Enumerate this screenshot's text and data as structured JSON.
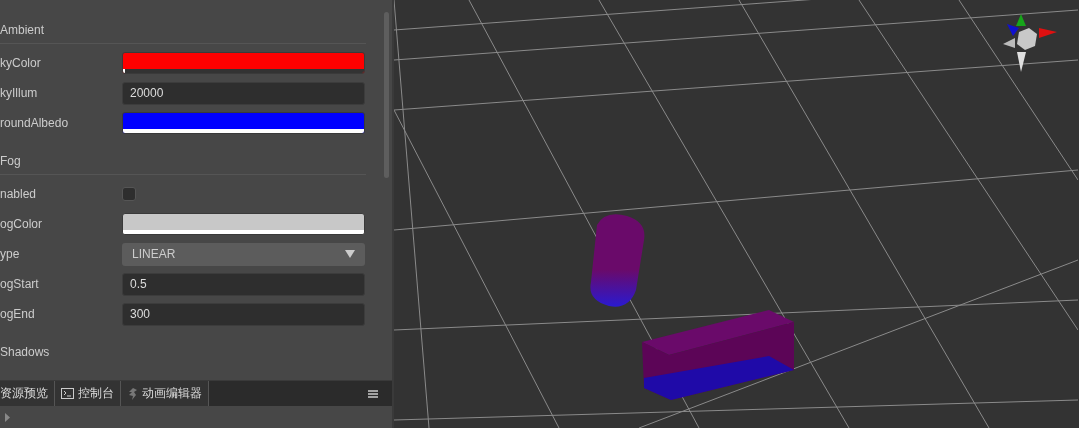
{
  "inspector": {
    "sections": [
      {
        "title": "Ambient",
        "rows": [
          {
            "kind": "color",
            "label": "kyColor",
            "color": "#ff0000",
            "level": 0.01
          },
          {
            "kind": "number",
            "label": "kyIllum",
            "value": "20000"
          },
          {
            "kind": "color",
            "label": "roundAlbedo",
            "color": "#0000ff",
            "level": 1
          }
        ]
      },
      {
        "title": "Fog",
        "rows": [
          {
            "kind": "checkbox",
            "label": "nabled",
            "checked": false
          },
          {
            "kind": "color",
            "label": "ogColor",
            "color": "#c8c8c8",
            "level": 1
          },
          {
            "kind": "select",
            "label": "ype",
            "value": "LINEAR"
          },
          {
            "kind": "number",
            "label": "ogStart",
            "value": "0.5"
          },
          {
            "kind": "number",
            "label": "ogEnd",
            "value": "300"
          }
        ]
      },
      {
        "title": "Shadows"
      }
    ]
  },
  "bottom_tabs": [
    {
      "kind": "plain",
      "label": "资源预览"
    },
    {
      "kind": "console",
      "label": "控制台"
    },
    {
      "kind": "animation",
      "label": "动画编辑器"
    }
  ]
}
